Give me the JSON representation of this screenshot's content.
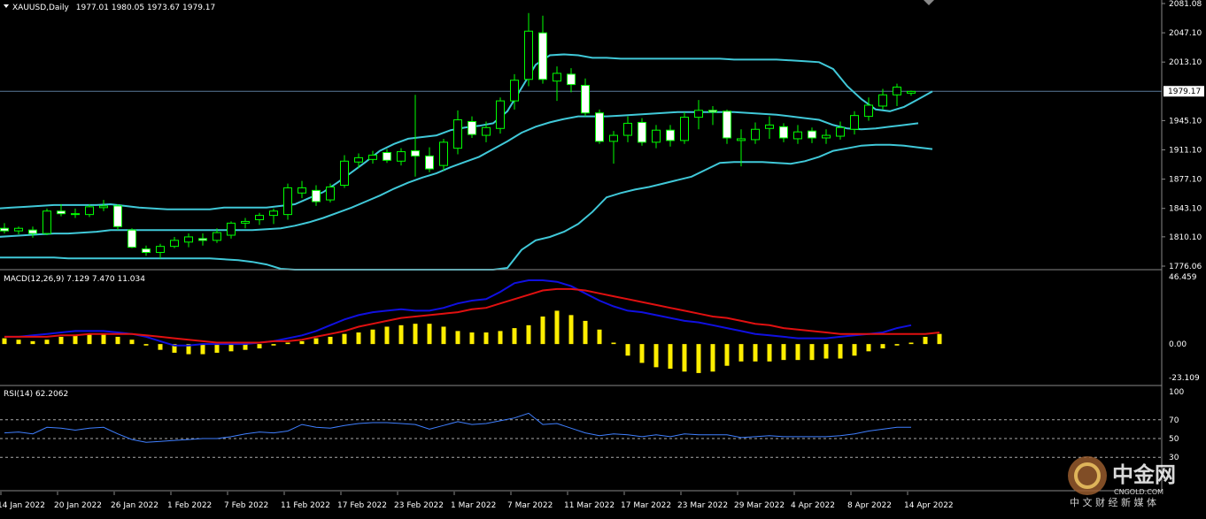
{
  "chart_data": {
    "type": "candlestick",
    "symbol": "XAUUSD,Daily",
    "ohlc_text": "1977.01 1980.05 1973.67 1979.17",
    "last_price_label": "1979.17",
    "last_price": 1979.17,
    "price_ylim": [
      1776.06,
      2081.08
    ],
    "price_ticks": [
      "2081.08",
      "2047.10",
      "2013.10",
      "1979.17",
      "1945.10",
      "1911.10",
      "1877.10",
      "1843.10",
      "1810.10",
      "1776.06"
    ],
    "x_labels": [
      "14 Jan 2022",
      "20 Jan 2022",
      "26 Jan 2022",
      "1 Feb 2022",
      "7 Feb 2022",
      "11 Feb 2022",
      "17 Feb 2022",
      "23 Feb 2022",
      "1 Mar 2022",
      "7 Mar 2022",
      "11 Mar 2022",
      "17 Mar 2022",
      "23 Mar 2022",
      "29 Mar 2022",
      "4 Apr 2022",
      "8 Apr 2022",
      "14 Apr 2022"
    ],
    "x_label_index": [
      0,
      4,
      8,
      12,
      16,
      20,
      24,
      28,
      32,
      36,
      40,
      44,
      48,
      52,
      56,
      60,
      64
    ],
    "candles": [
      {
        "o": 1820,
        "h": 1826,
        "l": 1814,
        "c": 1817
      },
      {
        "o": 1817,
        "h": 1822,
        "l": 1813,
        "c": 1820
      },
      {
        "o": 1818,
        "h": 1822,
        "l": 1809,
        "c": 1814
      },
      {
        "o": 1814,
        "h": 1843,
        "l": 1812,
        "c": 1840
      },
      {
        "o": 1840,
        "h": 1848,
        "l": 1834,
        "c": 1837
      },
      {
        "o": 1837,
        "h": 1843,
        "l": 1832,
        "c": 1836
      },
      {
        "o": 1836,
        "h": 1848,
        "l": 1833,
        "c": 1845
      },
      {
        "o": 1844,
        "h": 1853,
        "l": 1840,
        "c": 1846
      },
      {
        "o": 1846,
        "h": 1848,
        "l": 1818,
        "c": 1822
      },
      {
        "o": 1818,
        "h": 1820,
        "l": 1797,
        "c": 1798
      },
      {
        "o": 1796,
        "h": 1800,
        "l": 1788,
        "c": 1792
      },
      {
        "o": 1792,
        "h": 1802,
        "l": 1785,
        "c": 1799
      },
      {
        "o": 1799,
        "h": 1810,
        "l": 1797,
        "c": 1806
      },
      {
        "o": 1804,
        "h": 1814,
        "l": 1798,
        "c": 1810
      },
      {
        "o": 1808,
        "h": 1814,
        "l": 1800,
        "c": 1806
      },
      {
        "o": 1806,
        "h": 1820,
        "l": 1803,
        "c": 1815
      },
      {
        "o": 1812,
        "h": 1828,
        "l": 1808,
        "c": 1826
      },
      {
        "o": 1826,
        "h": 1832,
        "l": 1820,
        "c": 1828
      },
      {
        "o": 1830,
        "h": 1838,
        "l": 1824,
        "c": 1835
      },
      {
        "o": 1835,
        "h": 1843,
        "l": 1825,
        "c": 1840
      },
      {
        "o": 1836,
        "h": 1872,
        "l": 1830,
        "c": 1867
      },
      {
        "o": 1861,
        "h": 1875,
        "l": 1855,
        "c": 1867
      },
      {
        "o": 1864,
        "h": 1870,
        "l": 1846,
        "c": 1851
      },
      {
        "o": 1853,
        "h": 1872,
        "l": 1850,
        "c": 1868
      },
      {
        "o": 1870,
        "h": 1905,
        "l": 1867,
        "c": 1898
      },
      {
        "o": 1897,
        "h": 1907,
        "l": 1890,
        "c": 1902
      },
      {
        "o": 1900,
        "h": 1910,
        "l": 1895,
        "c": 1905
      },
      {
        "o": 1908,
        "h": 1912,
        "l": 1896,
        "c": 1899
      },
      {
        "o": 1898,
        "h": 1913,
        "l": 1893,
        "c": 1909
      },
      {
        "o": 1910,
        "h": 1975,
        "l": 1880,
        "c": 1904
      },
      {
        "o": 1904,
        "h": 1914,
        "l": 1885,
        "c": 1889
      },
      {
        "o": 1893,
        "h": 1924,
        "l": 1887,
        "c": 1920
      },
      {
        "o": 1913,
        "h": 1957,
        "l": 1906,
        "c": 1946
      },
      {
        "o": 1944,
        "h": 1950,
        "l": 1925,
        "c": 1929
      },
      {
        "o": 1928,
        "h": 1944,
        "l": 1920,
        "c": 1937
      },
      {
        "o": 1936,
        "h": 1972,
        "l": 1930,
        "c": 1968
      },
      {
        "o": 1968,
        "h": 1999,
        "l": 1958,
        "c": 1992
      },
      {
        "o": 1993,
        "h": 2070,
        "l": 1985,
        "c": 2049
      },
      {
        "o": 2047,
        "h": 2067,
        "l": 1988,
        "c": 1993
      },
      {
        "o": 1991,
        "h": 2008,
        "l": 1968,
        "c": 2000
      },
      {
        "o": 1999,
        "h": 2006,
        "l": 1978,
        "c": 1987
      },
      {
        "o": 1986,
        "h": 1994,
        "l": 1950,
        "c": 1954
      },
      {
        "o": 1954,
        "h": 1958,
        "l": 1918,
        "c": 1921
      },
      {
        "o": 1921,
        "h": 1933,
        "l": 1895,
        "c": 1928
      },
      {
        "o": 1928,
        "h": 1950,
        "l": 1920,
        "c": 1942
      },
      {
        "o": 1943,
        "h": 1948,
        "l": 1916,
        "c": 1920
      },
      {
        "o": 1920,
        "h": 1940,
        "l": 1913,
        "c": 1934
      },
      {
        "o": 1934,
        "h": 1940,
        "l": 1915,
        "c": 1922
      },
      {
        "o": 1922,
        "h": 1955,
        "l": 1918,
        "c": 1949
      },
      {
        "o": 1949,
        "h": 1969,
        "l": 1935,
        "c": 1957
      },
      {
        "o": 1957,
        "h": 1962,
        "l": 1940,
        "c": 1955
      },
      {
        "o": 1956,
        "h": 1958,
        "l": 1918,
        "c": 1925
      },
      {
        "o": 1922,
        "h": 1935,
        "l": 1892,
        "c": 1924
      },
      {
        "o": 1923,
        "h": 1943,
        "l": 1918,
        "c": 1935
      },
      {
        "o": 1936,
        "h": 1950,
        "l": 1924,
        "c": 1940
      },
      {
        "o": 1938,
        "h": 1942,
        "l": 1920,
        "c": 1925
      },
      {
        "o": 1924,
        "h": 1940,
        "l": 1918,
        "c": 1932
      },
      {
        "o": 1933,
        "h": 1937,
        "l": 1919,
        "c": 1925
      },
      {
        "o": 1925,
        "h": 1935,
        "l": 1918,
        "c": 1928
      },
      {
        "o": 1927,
        "h": 1944,
        "l": 1923,
        "c": 1937
      },
      {
        "o": 1935,
        "h": 1956,
        "l": 1929,
        "c": 1951
      },
      {
        "o": 1950,
        "h": 1972,
        "l": 1945,
        "c": 1963
      },
      {
        "o": 1962,
        "h": 1982,
        "l": 1958,
        "c": 1975
      },
      {
        "o": 1975,
        "h": 1988,
        "l": 1962,
        "c": 1984
      },
      {
        "o": 1977,
        "h": 1980,
        "l": 1974,
        "c": 1979
      }
    ],
    "bb_upper": [
      1843,
      1844,
      1845,
      1846,
      1847,
      1847,
      1847,
      1847,
      1848,
      1846,
      1844,
      1843,
      1842,
      1842,
      1842,
      1842,
      1844,
      1844,
      1844,
      1844,
      1846,
      1848,
      1855,
      1862,
      1873,
      1885,
      1897,
      1910,
      1918,
      1924,
      1926,
      1928,
      1934,
      1937,
      1939,
      1942,
      1956,
      1983,
      2010,
      2021,
      2022,
      2021,
      2018,
      2018,
      2017,
      2017,
      2017,
      2017,
      2017,
      2017,
      2017,
      2017,
      2016,
      2016,
      2016,
      2016,
      2015,
      2014,
      2013,
      2005,
      1985,
      1970,
      1958,
      1956,
      1961,
      1970,
      1979
    ],
    "bb_middle": [
      1810,
      1811,
      1812,
      1813,
      1814,
      1814,
      1815,
      1816,
      1818,
      1818,
      1818,
      1818,
      1818,
      1818,
      1818,
      1818,
      1818,
      1818,
      1818,
      1819,
      1820,
      1823,
      1827,
      1832,
      1838,
      1844,
      1851,
      1858,
      1866,
      1873,
      1879,
      1884,
      1891,
      1897,
      1903,
      1912,
      1921,
      1931,
      1938,
      1943,
      1947,
      1950,
      1950,
      1950,
      1951,
      1952,
      1953,
      1954,
      1955,
      1955,
      1955,
      1955,
      1955,
      1954,
      1953,
      1952,
      1950,
      1948,
      1946,
      1940,
      1936,
      1935,
      1936,
      1938,
      1940,
      1942
    ],
    "bb_lower": [
      1786,
      1786,
      1786,
      1786,
      1786,
      1785,
      1785,
      1785,
      1785,
      1785,
      1785,
      1785,
      1785,
      1785,
      1785,
      1785,
      1784,
      1783,
      1781,
      1778,
      1773,
      1768,
      1762,
      1756,
      1752,
      1748,
      1744,
      1740,
      1736,
      1732,
      1728,
      1726,
      1727,
      1731,
      1740,
      1755,
      1774,
      1795,
      1806,
      1810,
      1816,
      1825,
      1839,
      1856,
      1861,
      1865,
      1868,
      1872,
      1876,
      1880,
      1888,
      1896,
      1897,
      1897,
      1897,
      1896,
      1895,
      1898,
      1903,
      1910,
      1913,
      1916,
      1917,
      1917,
      1916,
      1914,
      1912
    ],
    "macd": {
      "label": "MACD(12,26,9) 7.129 7.470 11.034",
      "ylim": [
        -23.109,
        46.459
      ],
      "ticks": [
        "46.459",
        "0.00",
        "-23.109"
      ],
      "histogram": [
        4,
        3,
        2,
        3,
        5,
        6,
        7,
        7,
        5,
        3,
        -1,
        -4,
        -6,
        -7,
        -7,
        -6,
        -5,
        -4,
        -3,
        -1,
        1,
        2,
        4,
        5,
        7,
        8,
        10,
        12,
        13,
        14,
        14,
        12,
        9,
        8,
        8,
        9,
        11,
        13,
        19,
        23,
        20,
        16,
        10,
        1,
        -8,
        -13,
        -16,
        -17,
        -19,
        -20,
        -19,
        -15,
        -12,
        -12,
        -12,
        -11,
        -11,
        -11,
        -10,
        -10,
        -8,
        -5,
        -3,
        -1,
        1,
        5,
        7
      ],
      "macd_line": [
        5,
        5,
        6,
        7,
        8,
        9,
        9,
        9,
        8,
        7,
        5,
        2,
        -1,
        -1,
        0,
        0,
        0,
        0,
        1,
        2,
        4,
        6,
        9,
        13,
        17,
        20,
        22,
        23,
        24,
        23,
        23,
        25,
        28,
        30,
        31,
        36,
        42,
        44,
        44,
        43,
        40,
        35,
        30,
        26,
        23,
        22,
        20,
        18,
        16,
        15,
        13,
        11,
        9,
        7,
        6,
        5,
        4,
        4,
        4,
        5,
        6,
        7,
        8,
        11,
        13
      ],
      "signal_line": [
        5,
        5,
        5,
        5,
        6,
        6,
        7,
        7,
        7,
        7,
        6,
        5,
        4,
        3,
        2,
        1,
        1,
        1,
        1,
        2,
        2,
        3,
        5,
        7,
        9,
        12,
        14,
        16,
        18,
        19,
        20,
        21,
        22,
        24,
        25,
        28,
        31,
        34,
        37,
        38,
        38,
        37,
        35,
        33,
        31,
        29,
        27,
        25,
        23,
        21,
        19,
        18,
        16,
        14,
        13,
        11,
        10,
        9,
        8,
        7,
        7,
        7,
        7,
        7,
        7,
        7,
        8
      ]
    },
    "rsi": {
      "label": "RSI(14) 62.2062",
      "ylim": [
        0,
        100
      ],
      "ticks": [
        "100",
        "70",
        "50",
        "30"
      ],
      "levels": [
        70,
        50,
        30
      ],
      "values": [
        56,
        57,
        55,
        62,
        61,
        59,
        61,
        62,
        55,
        49,
        46,
        47,
        48,
        49,
        50,
        50,
        52,
        55,
        57,
        56,
        58,
        65,
        62,
        61,
        64,
        66,
        67,
        67,
        66,
        65,
        60,
        64,
        68,
        65,
        66,
        69,
        72,
        77,
        65,
        66,
        61,
        56,
        53,
        55,
        54,
        52,
        54,
        52,
        55,
        54,
        54,
        54,
        51,
        52,
        53,
        52,
        52,
        52,
        52,
        53,
        55,
        58,
        60,
        62,
        62
      ]
    },
    "colors": {
      "background": "#000000",
      "bull_candle_fill": "#000000",
      "bear_candle_fill": "#ffffff",
      "candle_outline": "#00ff00",
      "bollinger": "#40c8d8",
      "macd_line": "#1010e0",
      "signal_line": "#e01010",
      "histogram": "#ffee00",
      "rsi": "#3f7fff",
      "grid_text": "#ffffff"
    }
  },
  "watermark": {
    "brand": "中金网",
    "site": "CNGOLD.COM",
    "tagline": "中 文 财 经 新 媒 体"
  }
}
